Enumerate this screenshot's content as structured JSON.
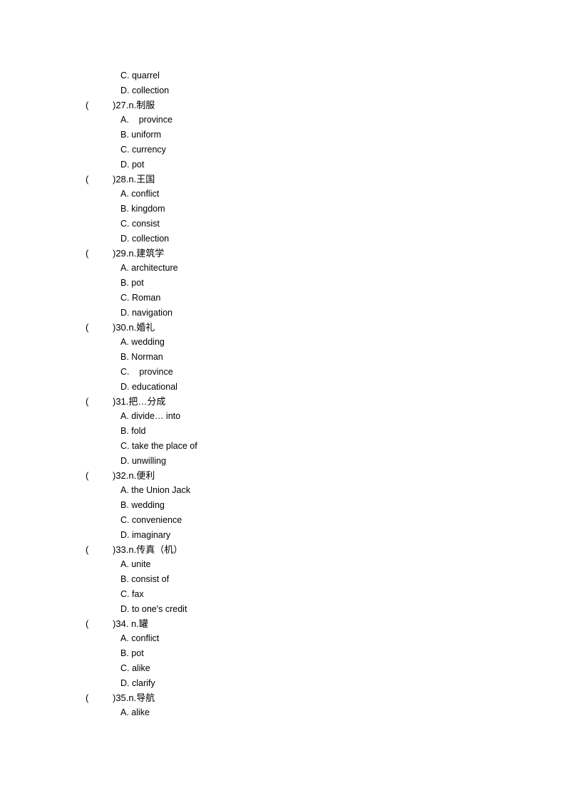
{
  "leading_options": [
    {
      "letter": "C.",
      "text": "quarrel"
    },
    {
      "letter": "D.",
      "text": "collection"
    }
  ],
  "questions": [
    {
      "number": ")27.",
      "prompt": "n.制服",
      "options": [
        {
          "letter": "A.",
          "text": "   province"
        },
        {
          "letter": "B.",
          "text": "uniform"
        },
        {
          "letter": "C.",
          "text": "currency"
        },
        {
          "letter": "D.",
          "text": "pot"
        }
      ]
    },
    {
      "number": ")28.",
      "prompt": "n.王国",
      "options": [
        {
          "letter": "A.",
          "text": "conflict"
        },
        {
          "letter": "B.",
          "text": "kingdom"
        },
        {
          "letter": "C.",
          "text": "consist"
        },
        {
          "letter": "D.",
          "text": "collection"
        }
      ]
    },
    {
      "number": ")29.",
      "prompt": "n.建筑学",
      "options": [
        {
          "letter": "A.",
          "text": "architecture"
        },
        {
          "letter": "B.",
          "text": "pot"
        },
        {
          "letter": "C.",
          "text": "Roman"
        },
        {
          "letter": "D.",
          "text": "navigation"
        }
      ]
    },
    {
      "number": ")30.",
      "prompt": "n.婚礼",
      "options": [
        {
          "letter": "A.",
          "text": "wedding"
        },
        {
          "letter": "B.",
          "text": "Norman"
        },
        {
          "letter": "C.",
          "text": "   province"
        },
        {
          "letter": "D.",
          "text": "educational"
        }
      ]
    },
    {
      "number": ")31.",
      "prompt": "把…分成",
      "options": [
        {
          "letter": "A.",
          "text": "divide… into"
        },
        {
          "letter": "B.",
          "text": "fold"
        },
        {
          "letter": "C.",
          "text": "take the place of"
        },
        {
          "letter": "D.",
          "text": "unwilling"
        }
      ]
    },
    {
      "number": ")32.",
      "prompt": "n.便利",
      "options": [
        {
          "letter": "A.",
          "text": "the Union Jack"
        },
        {
          "letter": "B.",
          "text": "wedding"
        },
        {
          "letter": "C.",
          "text": "convenience"
        },
        {
          "letter": "D.",
          "text": "imaginary"
        }
      ]
    },
    {
      "number": ")33.",
      "prompt": "n.传真（机）",
      "options": [
        {
          "letter": "A.",
          "text": "unite"
        },
        {
          "letter": "B.",
          "text": "consist of"
        },
        {
          "letter": "C.",
          "text": "fax"
        },
        {
          "letter": "D.",
          "text": "to one's credit"
        }
      ]
    },
    {
      "number": ")34.",
      "prompt": " n.罐",
      "options": [
        {
          "letter": "A.",
          "text": "conflict"
        },
        {
          "letter": "B.",
          "text": "pot"
        },
        {
          "letter": "C.",
          "text": "alike"
        },
        {
          "letter": "D.",
          "text": "clarify"
        }
      ]
    },
    {
      "number": ")35.",
      "prompt": "n.导航",
      "options": [
        {
          "letter": "A.",
          "text": "alike"
        }
      ]
    }
  ],
  "paren_open": "("
}
